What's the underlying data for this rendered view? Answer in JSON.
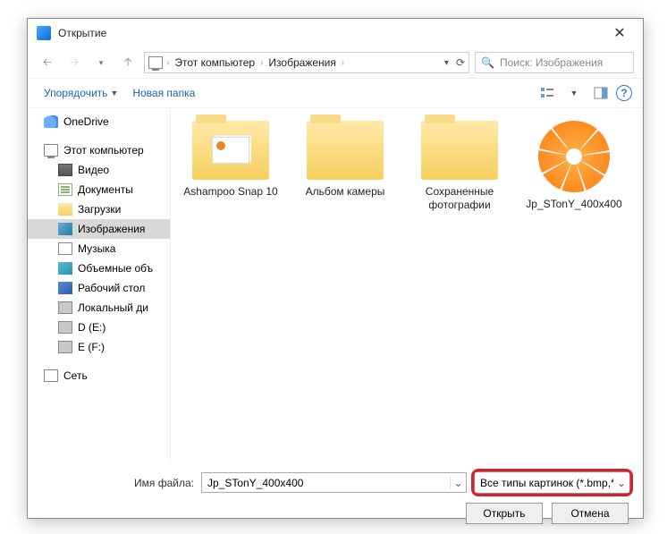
{
  "title": "Открытие",
  "nav": {
    "crumb1": "Этот компьютер",
    "crumb2": "Изображения",
    "search_placeholder": "Поиск: Изображения"
  },
  "toolbar": {
    "organize": "Упорядочить",
    "new_folder": "Новая папка"
  },
  "tree": {
    "onedrive": "OneDrive",
    "this_pc": "Этот компьютер",
    "video": "Видео",
    "documents": "Документы",
    "downloads": "Загрузки",
    "pictures": "Изображения",
    "music": "Музыка",
    "objects3d": "Объемные объ",
    "desktop": "Рабочий стол",
    "localdisk": "Локальный ди",
    "d_drive": "D (E:)",
    "e_drive": "E (F:)",
    "network": "Сеть"
  },
  "files": {
    "f1": "Ashampoo Snap 10",
    "f2": "Альбом камеры",
    "f3": "Сохраненные фотографии",
    "f4": "Jp_STonY_400x400"
  },
  "footer": {
    "filename_label": "Имя файла:",
    "filename_value": "Jp_STonY_400x400",
    "filetype_value": "Все типы картинок (*.bmp,*.d",
    "open": "Открыть",
    "cancel": "Отмена"
  }
}
